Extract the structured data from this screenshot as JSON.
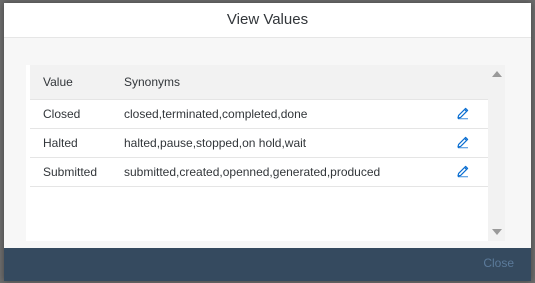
{
  "dialog": {
    "title": "View Values",
    "close_label": "Close"
  },
  "table": {
    "columns": [
      "Value",
      "Synonyms"
    ],
    "rows": [
      {
        "value": "Closed",
        "synonyms": "closed,terminated,completed,done",
        "action_icon": "pencil-icon"
      },
      {
        "value": "Halted",
        "synonyms": "halted,pause,stopped,on hold,wait",
        "action_icon": "pencil-icon"
      },
      {
        "value": "Submitted",
        "synonyms": "submitted,created,openned,generated,produced",
        "action_icon": "pencil-icon"
      }
    ]
  },
  "colors": {
    "footer": "#354a5f",
    "close_text": "#5b7a9a",
    "edit_icon": "#0a6ed1",
    "header_row": "#f2f2f2"
  }
}
